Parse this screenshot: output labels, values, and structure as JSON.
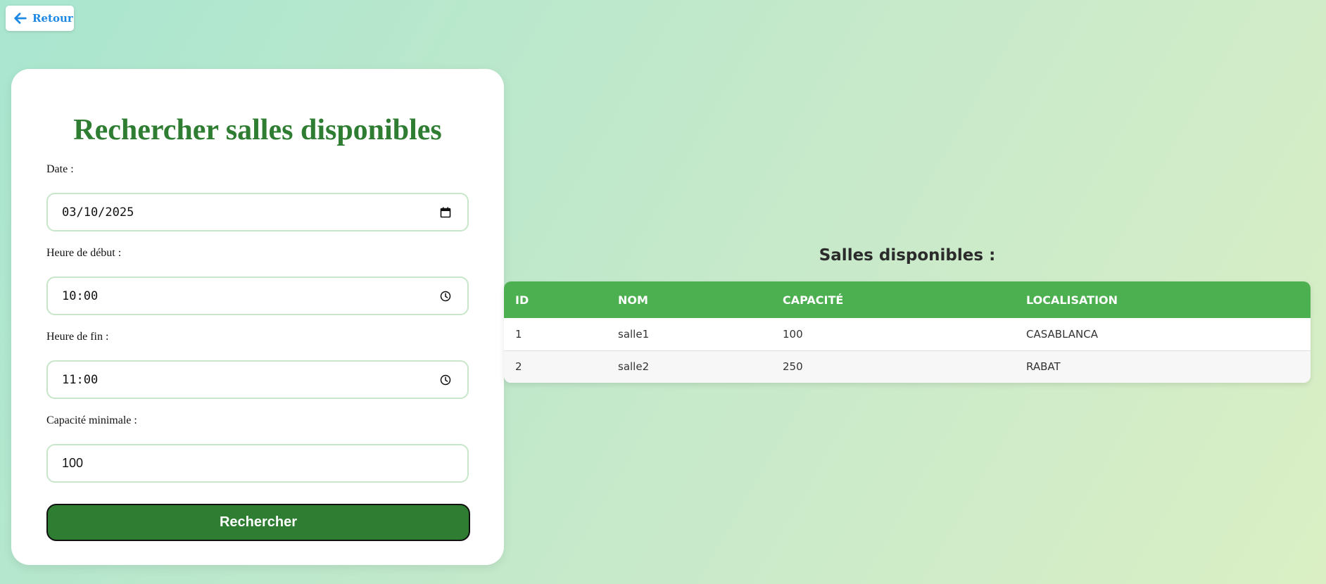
{
  "back_button": {
    "label": "Retour"
  },
  "form": {
    "title": "Rechercher salles disponibles",
    "date": {
      "label": "Date :",
      "value": "03/10/2025"
    },
    "start": {
      "label": "Heure de début :",
      "value": "10:00"
    },
    "end": {
      "label": "Heure de fin :",
      "value": "11:00"
    },
    "capacity": {
      "label": "Capacité minimale :",
      "value": "100"
    },
    "submit_label": "Rechercher"
  },
  "results": {
    "title": "Salles disponibles :",
    "columns": [
      "ID",
      "NOM",
      "CAPACITÉ",
      "LOCALISATION"
    ],
    "rows": [
      [
        "1",
        "salle1",
        "100",
        "CASABLANCA"
      ],
      [
        "2",
        "salle2",
        "250",
        "RABAT"
      ]
    ]
  },
  "colors": {
    "accent": "#2e7d32",
    "table_header": "#4caf50",
    "link": "#1e88e5"
  }
}
